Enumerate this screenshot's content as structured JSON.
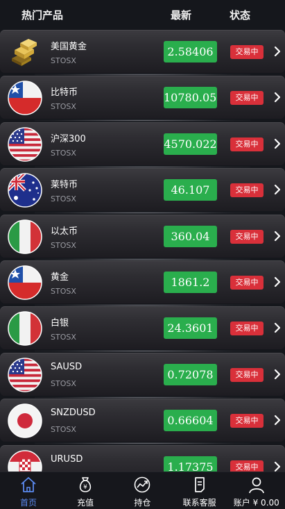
{
  "header": {
    "col_name": "热门产品",
    "col_price": "最新",
    "col_status": "状态"
  },
  "rows": [
    {
      "name": "美国黄金",
      "code": "STOSX",
      "price": "2.58406",
      "status": "交易中",
      "icon": "gold-bars-icon"
    },
    {
      "name": "比特币",
      "code": "STOSX",
      "price": "10780.057",
      "status": "交易中",
      "icon": "chile-flag-icon"
    },
    {
      "name": "沪深300",
      "code": "STOSX",
      "price": "4570.022",
      "status": "交易中",
      "icon": "usa-flag-icon"
    },
    {
      "name": "莱特币",
      "code": "STOSX",
      "price": "46.107",
      "status": "交易中",
      "icon": "australia-flag-icon"
    },
    {
      "name": "以太币",
      "code": "STOSX",
      "price": "360.04",
      "status": "交易中",
      "icon": "italy-flag-icon"
    },
    {
      "name": "黄金",
      "code": "STOSX",
      "price": "1861.2",
      "status": "交易中",
      "icon": "chile-flag-icon"
    },
    {
      "name": "白银",
      "code": "STOSX",
      "price": "24.3601",
      "status": "交易中",
      "icon": "italy-flag-icon"
    },
    {
      "name": "SAUSD",
      "code": "STOSX",
      "price": "0.72078",
      "status": "交易中",
      "icon": "usa-flag-icon"
    },
    {
      "name": "SNZDUSD",
      "code": "STOSX",
      "price": "0.66604",
      "status": "交易中",
      "icon": "japan-flag-icon"
    },
    {
      "name": "URUSD",
      "code": "STOSX",
      "price": "1.17375",
      "status": "交易中",
      "icon": "croatia-flag-icon"
    }
  ],
  "tabs": [
    {
      "label": "首页",
      "icon": "home-icon",
      "active": true
    },
    {
      "label": "充值",
      "icon": "money-bag-icon",
      "active": false
    },
    {
      "label": "持仓",
      "icon": "trend-chart-icon",
      "active": false
    },
    {
      "label": "联系客服",
      "icon": "document-icon",
      "active": false
    },
    {
      "label": "账户 ¥ 0.00",
      "icon": "user-icon",
      "active": false
    }
  ],
  "colors": {
    "price_bg": "#2aae4d",
    "status_bg": "#d9303a",
    "active_tab": "#5b8af0",
    "background": "#15171c"
  }
}
